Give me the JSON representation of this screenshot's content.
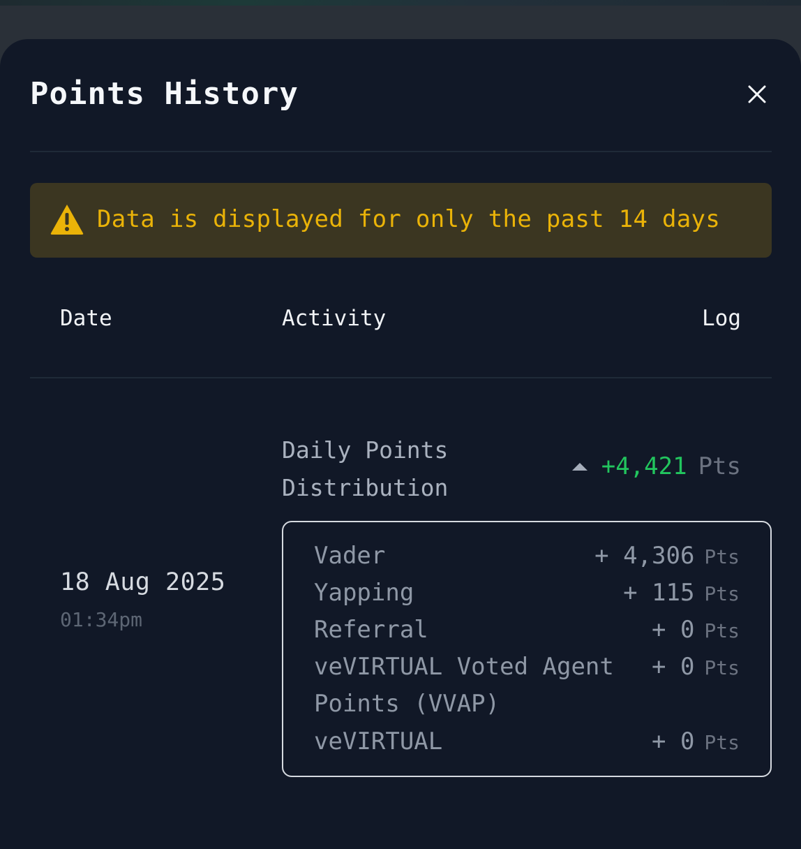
{
  "title": "Points History",
  "notice": "Data is displayed for only the past 14 days",
  "columns": {
    "date": "Date",
    "activity": "Activity",
    "log": "Log"
  },
  "entry": {
    "date": "18 Aug 2025",
    "time": "01:34pm",
    "activity": "Daily Points Distribution",
    "log_value": "+4,421",
    "log_unit": "Pts",
    "breakdown": [
      {
        "name": "Vader",
        "amount": "+ 4,306",
        "unit": "Pts"
      },
      {
        "name": "Yapping",
        "amount": "+ 115",
        "unit": "Pts"
      },
      {
        "name": "Referral",
        "amount": "+ 0",
        "unit": "Pts"
      },
      {
        "name": "veVIRTUAL Voted Agent Points (VVAP)",
        "amount": "+ 0",
        "unit": "Pts"
      },
      {
        "name": "veVIRTUAL",
        "amount": "+ 0",
        "unit": "Pts"
      }
    ]
  },
  "colors": {
    "background": "#111827",
    "positive": "#22c55e",
    "warning": "#eab308",
    "warning_bg": "#3b3621"
  },
  "icons": {
    "close": "close-icon",
    "warning": "warning-icon",
    "trend": "triangle-up-icon"
  }
}
